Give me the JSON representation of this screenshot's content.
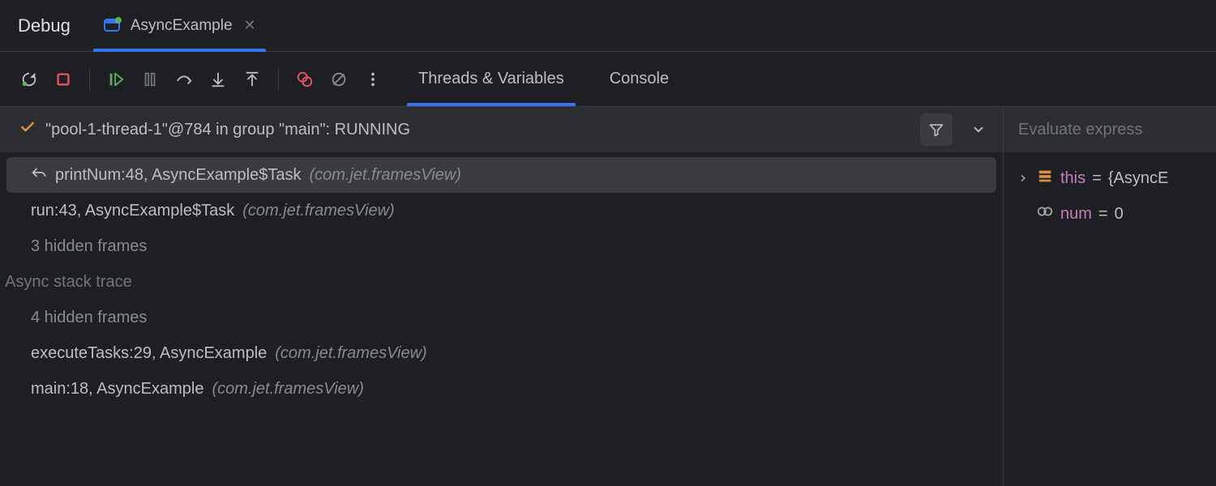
{
  "title": "Debug",
  "tab": {
    "label": "AsyncExample"
  },
  "sub_tabs": {
    "threads": "Threads & Variables",
    "console": "Console"
  },
  "thread": {
    "text": "\"pool-1-thread-1\"@784 in group \"main\": RUNNING"
  },
  "frames": {
    "section_async": "Async stack trace",
    "items": [
      {
        "mono": "printNum:48, AsyncExample$Task",
        "pkg": "(com.jet.framesView)",
        "selected": true,
        "back": true
      },
      {
        "mono": "run:43, AsyncExample$Task",
        "pkg": "(com.jet.framesView)"
      },
      {
        "mono": "3 hidden frames",
        "dim": true
      },
      {
        "section": true
      },
      {
        "mono": "4 hidden frames",
        "dim": true
      },
      {
        "mono": "executeTasks:29, AsyncExample",
        "pkg": "(com.jet.framesView)"
      },
      {
        "mono": "main:18, AsyncExample",
        "pkg": "(com.jet.framesView)"
      }
    ]
  },
  "vars": {
    "eval_placeholder": "Evaluate express",
    "items": [
      {
        "name": "this",
        "value": "{AsyncE",
        "icon": "object",
        "expandable": true
      },
      {
        "name": "num",
        "value": "0",
        "icon": "glasses"
      }
    ]
  }
}
